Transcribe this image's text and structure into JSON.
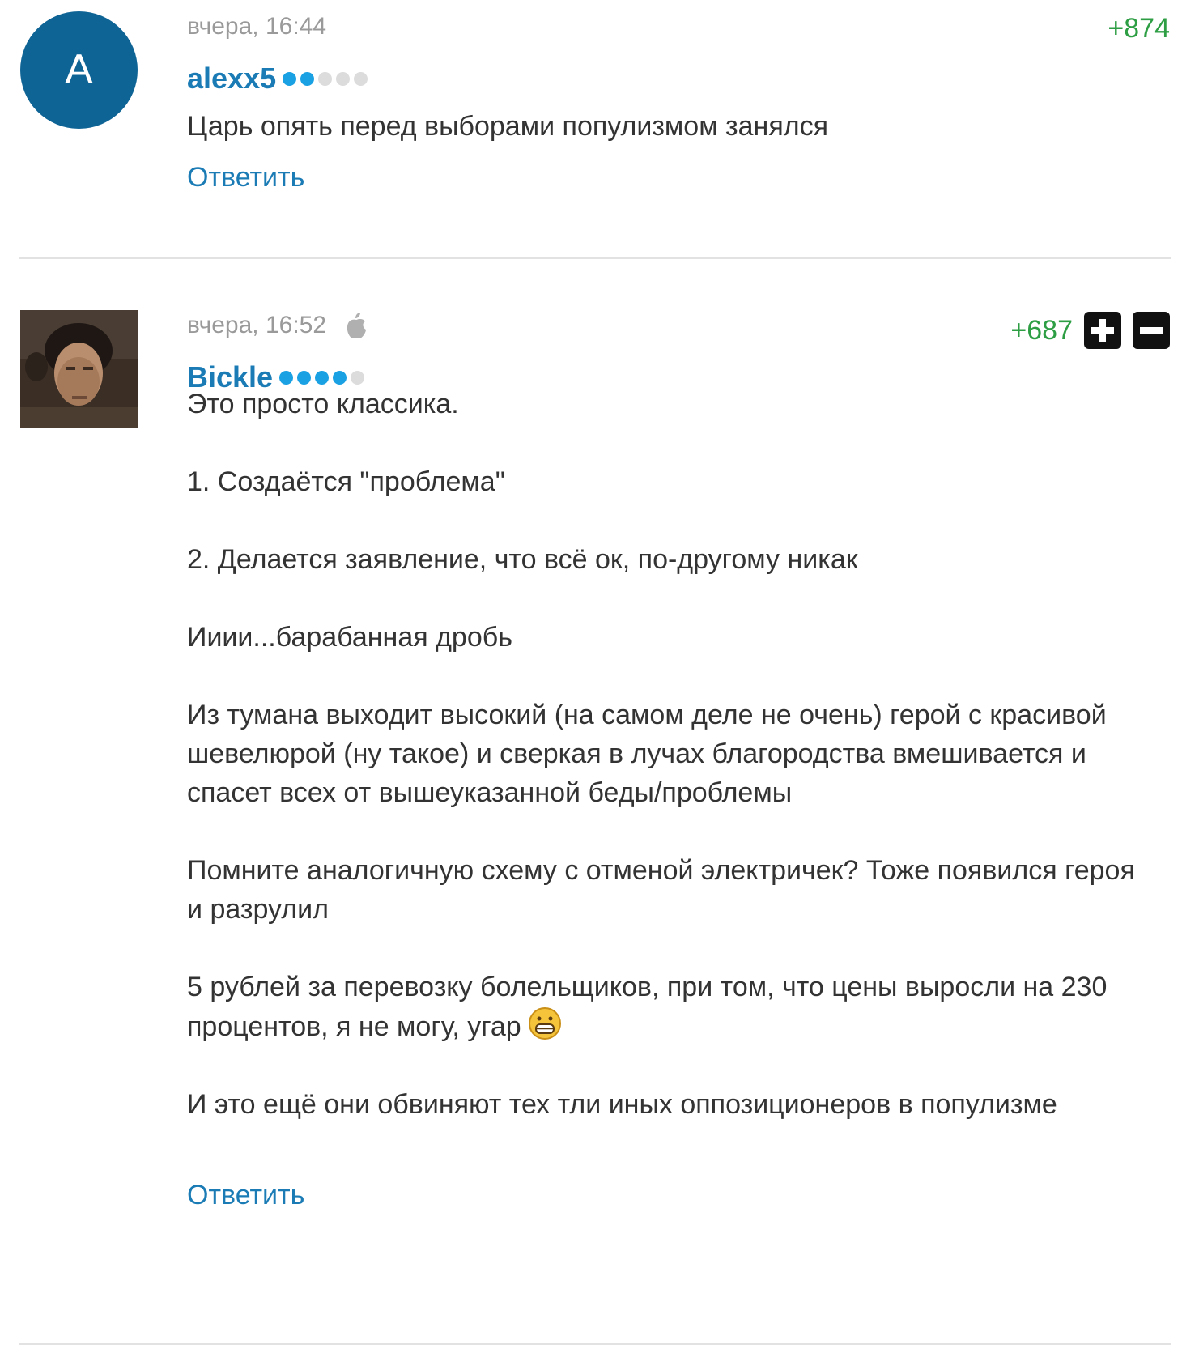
{
  "comments": [
    {
      "avatar_letter": "A",
      "avatar_color": "#0f6496",
      "timestamp": "вчера, 16:44",
      "username": "alexx5",
      "rating_filled": 2,
      "rating_total": 5,
      "score": "+874",
      "paragraphs": [
        "Царь опять перед выборами популизмом занялся"
      ],
      "reply_label": "Ответить"
    },
    {
      "avatar_type": "photo",
      "timestamp": "вчера, 16:52",
      "device_icon": "apple-icon",
      "username": "Bickle",
      "rating_filled": 4,
      "rating_total": 5,
      "score": "+687",
      "vote_up_icon": "plus-icon",
      "vote_down_icon": "minus-icon",
      "paragraphs": [
        "Это просто классика.",
        "1. Создаётся \"проблема\"",
        "2. Делается заявление, что всё ок, по-другому никак",
        "Ииии...барабанная дробь",
        "Из тумана выходит высокий (на самом деле не очень) герой с красивой шевелюрой (ну такое) и сверкая в лучах благородства вмешивается и спасет всех от вышеуказанной беды/проблемы",
        "Помните аналогичную схему с отменой электричек? Тоже появился героя и разрулил",
        "5 рублей за перевозку болельщиков, при том, что цены выросли на 230 процентов, я не могу, угар",
        "И это ещё они обвиняют тех тли иных оппозиционеров в популизме"
      ],
      "emoji_icon": "grinning-face-emoji-icon",
      "reply_label": "Ответить"
    }
  ],
  "colors": {
    "username": "#1a7bb5",
    "score_positive": "#2e9e44",
    "rating_on": "#1aa1e3",
    "rating_off": "#dcdcdc",
    "meta": "#9a9a9a"
  }
}
